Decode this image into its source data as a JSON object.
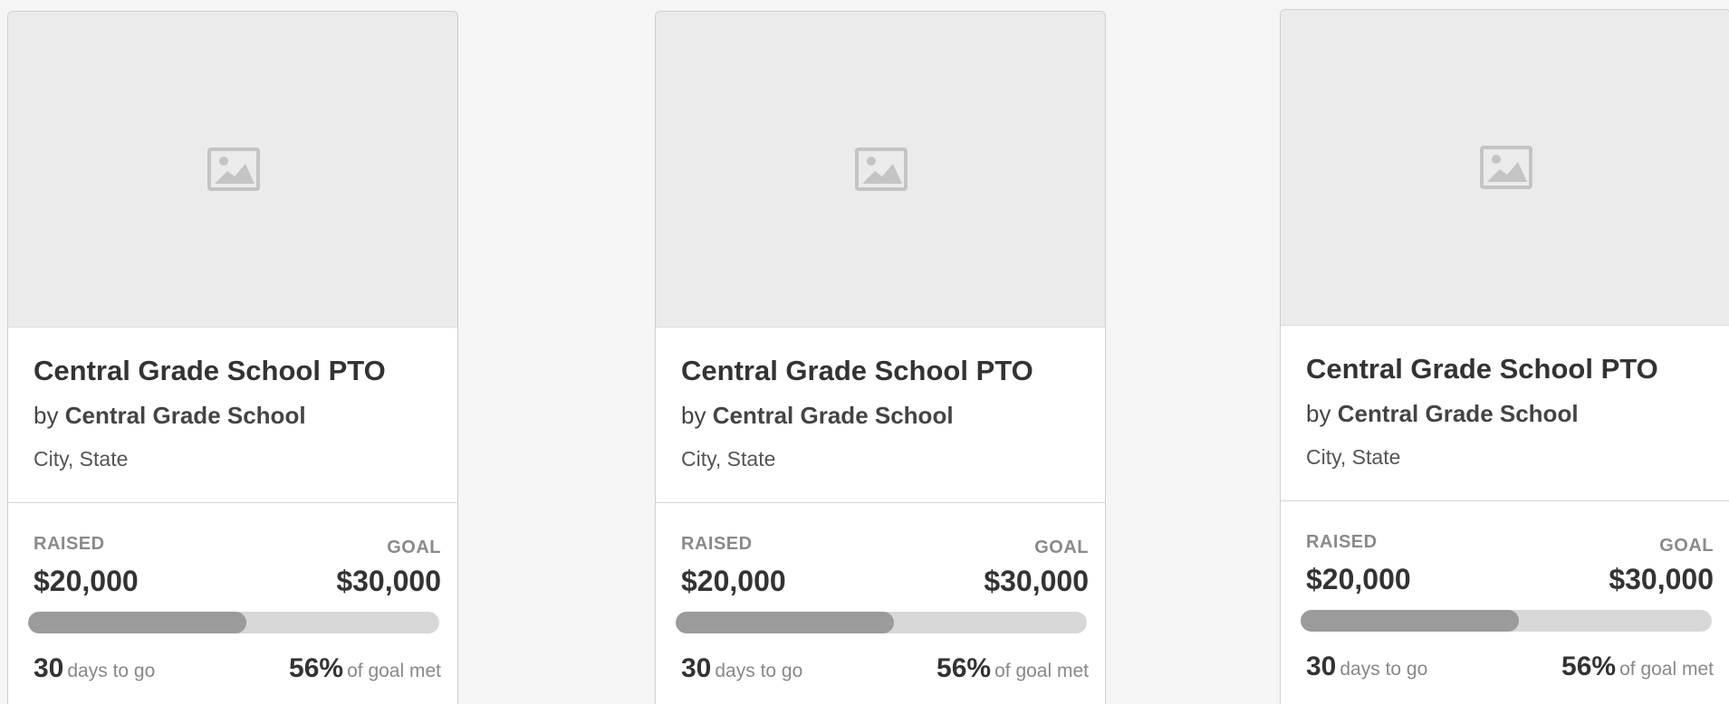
{
  "cards": [
    {
      "image_icon": "image-placeholder-icon",
      "title": "Central Grade School PTO",
      "by_prefix": "by",
      "organization": "Central Grade School",
      "location": "City, State",
      "raised_label": "RAISED",
      "raised_amount": "$20,000",
      "goal_label": "GOAL",
      "goal_amount": "$30,000",
      "progress_fraction": 0.53,
      "days_value": "30",
      "days_text": "days to go",
      "percent_value": "56%",
      "percent_text": "of goal met"
    },
    {
      "image_icon": "image-placeholder-icon",
      "title": "Central Grade School PTO",
      "by_prefix": "by",
      "organization": "Central Grade School",
      "location": "City, State",
      "raised_label": "RAISED",
      "raised_amount": "$20,000",
      "goal_label": "GOAL",
      "goal_amount": "$30,000",
      "progress_fraction": 0.53,
      "days_value": "30",
      "days_text": "days to go",
      "percent_value": "56%",
      "percent_text": "of goal met"
    },
    {
      "image_icon": "image-placeholder-icon",
      "title": "Central Grade School PTO",
      "by_prefix": "by",
      "organization": "Central Grade School",
      "location": "City, State",
      "raised_label": "RAISED",
      "raised_amount": "$20,000",
      "goal_label": "GOAL",
      "goal_amount": "$30,000",
      "progress_fraction": 0.53,
      "days_value": "30",
      "days_text": "days to go",
      "percent_value": "56%",
      "percent_text": "of goal met"
    }
  ],
  "colors": {
    "background": "#f5f5f5",
    "card": "#ffffff",
    "image_placeholder": "#ebebeb",
    "progress_track": "#d7d7d7",
    "progress_fill": "#9b9b9b"
  }
}
